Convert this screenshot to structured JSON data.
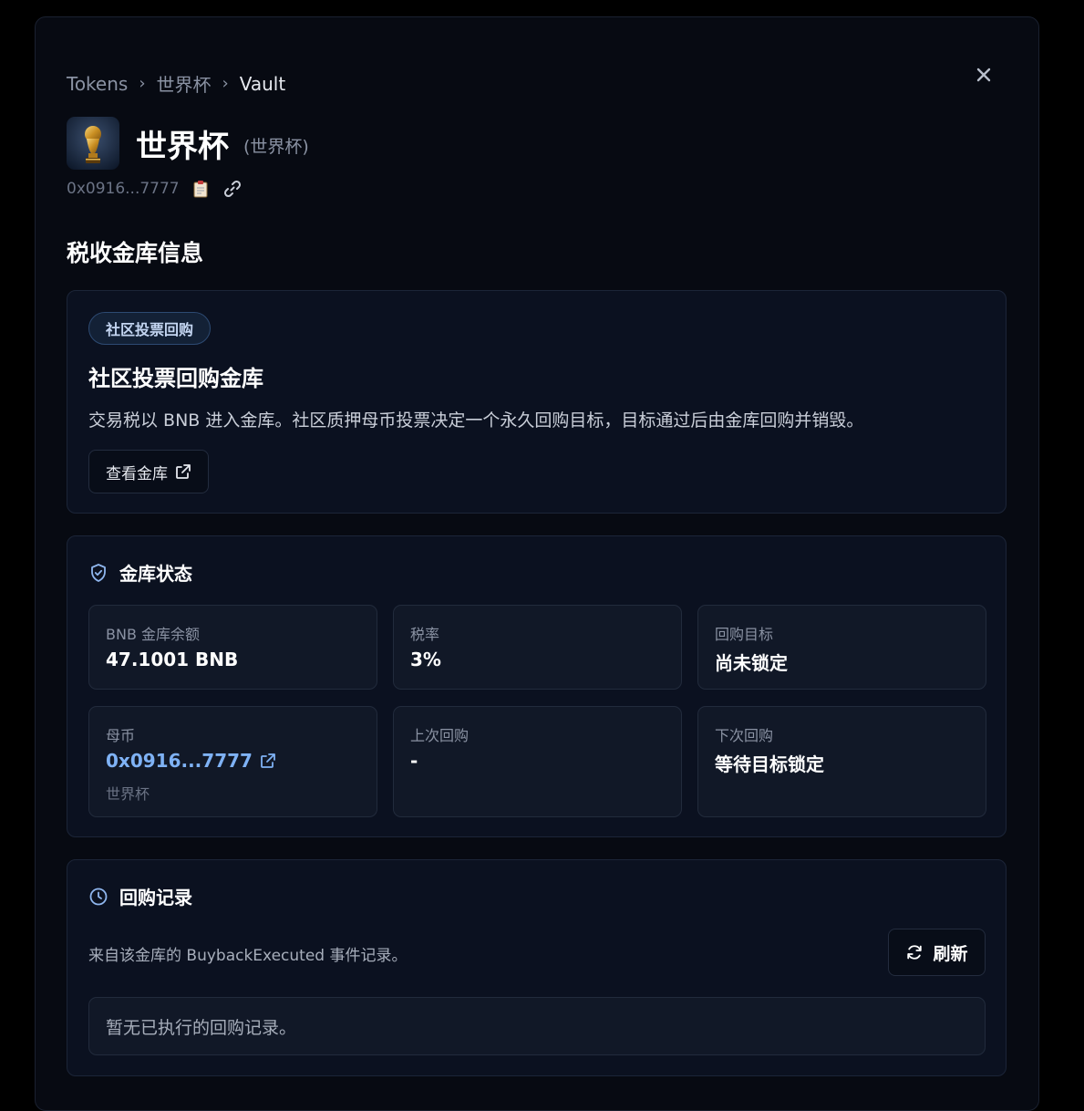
{
  "breadcrumb": {
    "items": [
      "Tokens",
      "世界杯"
    ],
    "current": "Vault",
    "separator": "›"
  },
  "token": {
    "logo_icon": "trophy-icon",
    "name": "世界杯",
    "symbol": "(世界杯)",
    "address": "0x0916...7777"
  },
  "section_title": "税收金库信息",
  "vault_info": {
    "badge": "社区投票回购",
    "title": "社区投票回购金库",
    "description": "交易税以 BNB 进入金库。社区质押母币投票决定一个永久回购目标，目标通过后由金库回购并销毁。",
    "view_button": "查看金库"
  },
  "vault_status": {
    "heading": "金库状态",
    "stats": [
      {
        "label": "BNB 金库余额",
        "value": "47.1001 BNB"
      },
      {
        "label": "税率",
        "value": "3%"
      },
      {
        "label": "回购目标",
        "value": "尚未锁定"
      },
      {
        "label": "母币",
        "value": "0x0916...7777",
        "sub": "世界杯"
      },
      {
        "label": "上次回购",
        "value": "-"
      },
      {
        "label": "下次回购",
        "value": "等待目标锁定"
      }
    ]
  },
  "buyback_history": {
    "heading": "回购记录",
    "description": "来自该金库的 BuybackExecuted 事件记录。",
    "refresh_button": "刷新",
    "empty_text": "暂无已执行的回购记录。"
  },
  "colors": {
    "background": "#000000",
    "panel": "#070a12",
    "card": "#0b1120",
    "stat_card": "#111827",
    "link": "#7fb2f5",
    "badge_border": "#2d4a72"
  }
}
